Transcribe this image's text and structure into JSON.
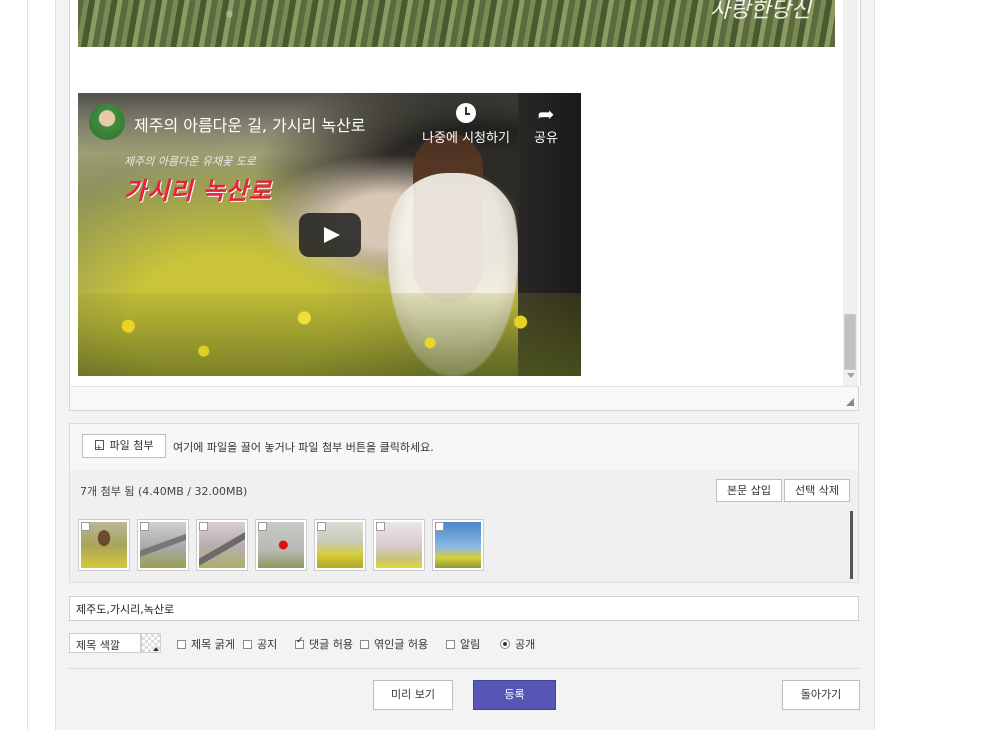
{
  "editor": {
    "top_image_signature": "사랑한당신",
    "video": {
      "title": "제주의 아름다운 길, 가시리 녹산로",
      "watch_later_label": "나중에 시청하기",
      "share_label": "공유",
      "overlay_small": "제주의 아름다운 유채꽃 도로",
      "overlay_big": "가시리 녹산로"
    }
  },
  "attach": {
    "button_label": "파일 첨부",
    "hint": "여기에 파일을 끌어 놓거나 파일 첨부 버튼을 클릭하세요.",
    "status": "7개 첨부 됨 (4.40MB / 32.00MB)",
    "insert_label": "본문 삽입",
    "delete_label": "선택 삭제",
    "thumbnails": [
      {
        "icon": "photo-woman-canola"
      },
      {
        "icon": "photo-road-fog"
      },
      {
        "icon": "photo-road-cherry"
      },
      {
        "icon": "photo-red-umbrella"
      },
      {
        "icon": "photo-canola-field"
      },
      {
        "icon": "photo-cherry-trees"
      },
      {
        "icon": "photo-windmill-sky"
      }
    ]
  },
  "tags": {
    "value": "제주도,가시리,녹산로"
  },
  "options": {
    "title_color": "제목 색깔",
    "bold_title": "제목 굵게",
    "notice": "공지",
    "allow_comment": "댓글 허용",
    "allow_trackback": "엮인글 허용",
    "notify": "알림",
    "public": "공개"
  },
  "actions": {
    "preview": "미리 보기",
    "submit": "등록",
    "back": "돌아가기"
  },
  "colors": {
    "submit_bg": "#5656b6"
  }
}
